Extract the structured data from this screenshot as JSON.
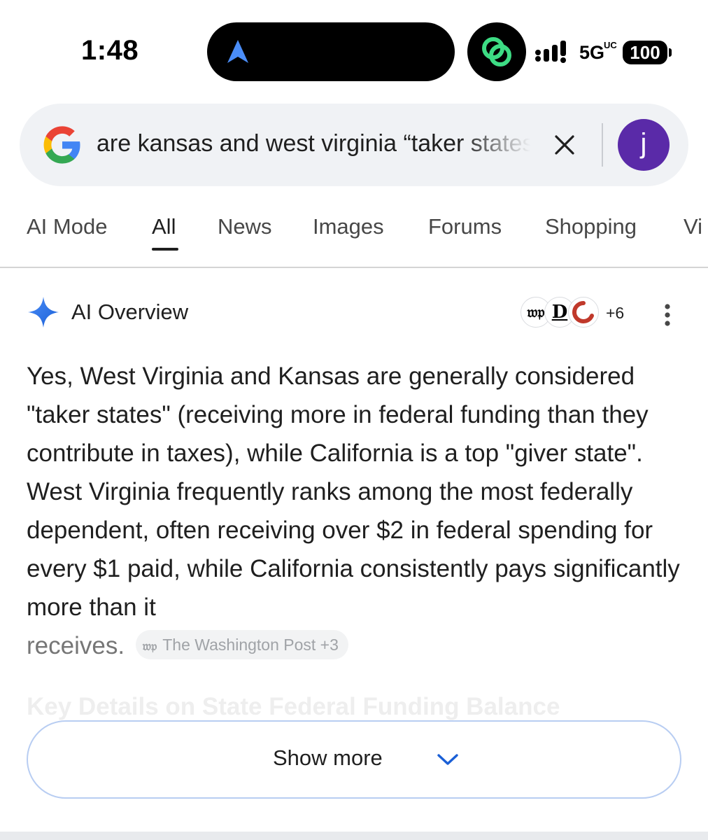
{
  "status_bar": {
    "time": "1:48",
    "network": "5G",
    "network_sup": "UC",
    "battery": "100",
    "icons": [
      "navigation-arrow-icon",
      "linked-circles-icon",
      "signal-bars-icon"
    ]
  },
  "search": {
    "query": "are kansas and west virginia “taker states”",
    "avatar_letter": "j",
    "icons": [
      "google-g-icon",
      "clear-icon"
    ]
  },
  "tabs": [
    {
      "label": "AI Mode",
      "active": false
    },
    {
      "label": "All",
      "active": true
    },
    {
      "label": "News",
      "active": false
    },
    {
      "label": "Images",
      "active": false
    },
    {
      "label": "Forums",
      "active": false
    },
    {
      "label": "Shopping",
      "active": false
    },
    {
      "label": "Vi",
      "active": false
    }
  ],
  "ai_overview": {
    "title": "AI Overview",
    "source_icons": [
      "𝔴𝔭",
      "D"
    ],
    "sources_more": "+6",
    "body_line1": "Yes, West Virginia and Kansas are generally considered \"taker states\" (receiving more in federal funding than they contribute in taxes), while California is a top \"giver state\". West Virginia frequently ranks among the most federally dependent, often receiving over $2 in federal spending for every $1 paid, while California consistently pays significantly more than it",
    "body_line_faded": "receives.",
    "citation": {
      "logo": "𝔴𝔭",
      "label": "The Washington Post +3"
    },
    "next_heading": "Key Details on State Federal Funding Balance",
    "show_more": "Show more"
  },
  "colors": {
    "accent_blue": "#1a73e8",
    "avatar_purple": "#5a2aa8",
    "link_green": "#3ddc84",
    "search_bg": "#f0f2f5"
  }
}
